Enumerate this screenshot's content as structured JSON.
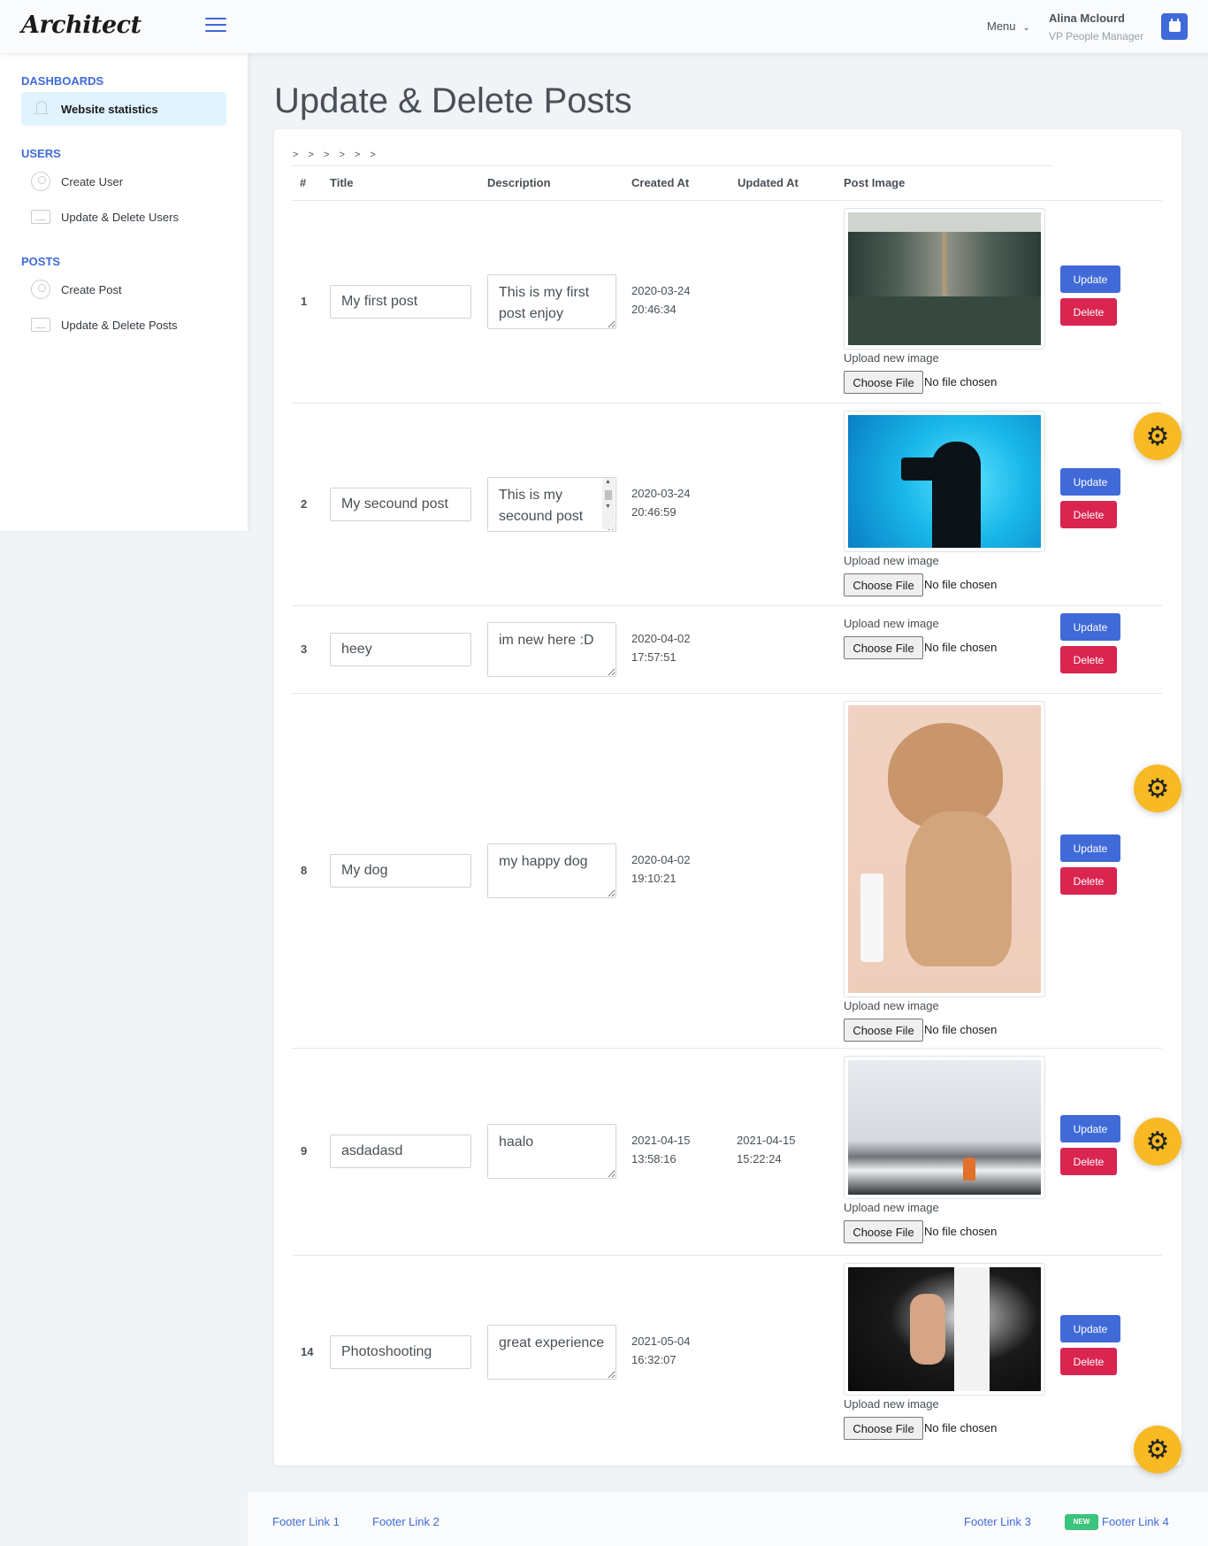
{
  "app": {
    "logo": "Architect"
  },
  "header": {
    "menu_label": "Menu",
    "user_name": "Alina Mclourd",
    "user_role": "VP People Manager"
  },
  "sidebar": {
    "sections": [
      {
        "heading": "DASHBOARDS",
        "items": [
          {
            "label": "Website statistics",
            "icon": "bell-icon",
            "active": true
          }
        ]
      },
      {
        "heading": "USERS",
        "items": [
          {
            "label": "Create User",
            "icon": "user-icon"
          },
          {
            "label": "Update & Delete Users",
            "icon": "screen-icon"
          }
        ]
      },
      {
        "heading": "POSTS",
        "items": [
          {
            "label": "Create Post",
            "icon": "user-icon"
          },
          {
            "label": "Update & Delete Posts",
            "icon": "screen-icon"
          }
        ]
      }
    ]
  },
  "page": {
    "title": "Update & Delete Posts",
    "breadcrumbs": "> > > > > >"
  },
  "table": {
    "headers": [
      "#",
      "Title",
      "Description",
      "Created At",
      "Updated At",
      "Post Image"
    ],
    "upload_label": "Upload new image",
    "choose_file_label": "Choose File",
    "no_file_label": "No file chosen",
    "update_label": "Update",
    "delete_label": "Delete",
    "rows": [
      {
        "id": "1",
        "title": "My first post",
        "description": "This is my first post enjoy",
        "created_date": "2020-03-24",
        "created_time": "20:46:34",
        "updated_date": "",
        "updated_time": "",
        "image": "train-interior"
      },
      {
        "id": "2",
        "title": "My secound post",
        "description": "This is my secound post",
        "created_date": "2020-03-24",
        "created_time": "20:46:59",
        "updated_date": "",
        "updated_time": "",
        "image": "photographer-silhouette"
      },
      {
        "id": "3",
        "title": "heey",
        "description": "im new here :D",
        "created_date": "2020-04-02",
        "created_time": "17:57:51",
        "updated_date": "",
        "updated_time": "",
        "image": ""
      },
      {
        "id": "8",
        "title": "My dog",
        "description": "my happy dog",
        "created_date": "2020-04-02",
        "created_time": "19:10:21",
        "updated_date": "",
        "updated_time": "",
        "image": "dog"
      },
      {
        "id": "9",
        "title": "asdadasd",
        "description": "haalo",
        "created_date": "2021-04-15",
        "created_time": "13:58:16",
        "updated_date": "2021-04-15",
        "updated_time": "15:22:24",
        "image": "snowy-mountain"
      },
      {
        "id": "14",
        "title": "Photoshooting",
        "description": "great experience",
        "created_date": "2021-05-04",
        "created_time": "16:32:07",
        "updated_date": "",
        "updated_time": "",
        "image": "thumbs-up"
      }
    ]
  },
  "footer": {
    "links": [
      "Footer Link 1",
      "Footer Link 2",
      "Footer Link 3",
      "Footer Link 4"
    ],
    "badge": "NEW"
  },
  "colors": {
    "primary": "#3f6ad8",
    "danger": "#d92550",
    "warning": "#f7b924",
    "success": "#3ac47d"
  }
}
